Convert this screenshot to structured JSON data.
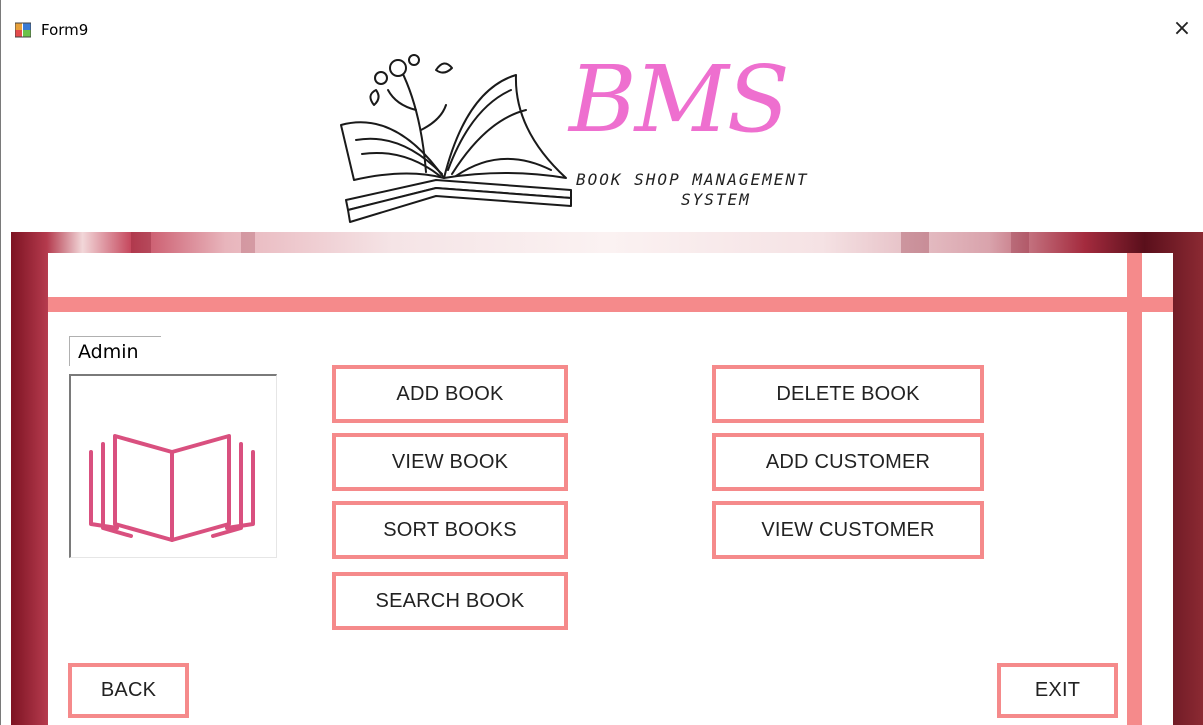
{
  "window": {
    "title": "Form9",
    "close_glyph": "×"
  },
  "logo": {
    "brand": "BMS",
    "subtitle_line1": "BOOK SHOP MANAGEMENT",
    "subtitle_line2": "SYSTEM",
    "icon": "open-book-illustration"
  },
  "user": {
    "label": "Admin",
    "picture_icon": "open-book-icon"
  },
  "buttons": {
    "add_book": "ADD BOOK",
    "view_book": "VIEW BOOK",
    "sort_books": "SORT BOOKS",
    "search_book": "SEARCH BOOK",
    "delete_book": "DELETE BOOK",
    "add_customer": "ADD CUSTOMER",
    "view_customer": "VIEW CUSTOMER",
    "back": "BACK",
    "exit": "EXIT"
  },
  "colors": {
    "accent": "#f58a8b",
    "brand_pink": "#ee6fcf",
    "book_icon": "#d9507f"
  }
}
